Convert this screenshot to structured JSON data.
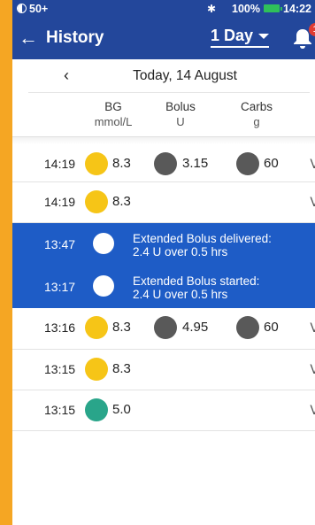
{
  "status": {
    "left": "50+",
    "battery": "100%",
    "clock": "14:22"
  },
  "header": {
    "title": "History",
    "range": "1 Day",
    "notifications": "1"
  },
  "date": "Today, 14 August",
  "columns": [
    {
      "name": "BG",
      "unit": "mmol/L"
    },
    {
      "name": "Bolus",
      "unit": "U"
    },
    {
      "name": "Carbs",
      "unit": "g"
    }
  ],
  "rows": [
    {
      "time": "14:19",
      "bg": "8.3",
      "bolus": "3.15",
      "carbs": "60"
    },
    {
      "time": "14:19",
      "bg": "8.3"
    },
    {
      "time": "13:47",
      "line1": "Extended Bolus delivered:",
      "line2": "2.4 U over 0.5 hrs"
    },
    {
      "time": "13:17",
      "line1": "Extended Bolus started:",
      "line2": "2.4 U over 0.5 hrs"
    },
    {
      "time": "13:16",
      "bg": "8.3",
      "bolus": "4.95",
      "carbs": "60"
    },
    {
      "time": "13:15",
      "bg": "8.3"
    },
    {
      "time": "13:15",
      "bg": "5.0"
    }
  ],
  "colors": {
    "header": "#23479b",
    "highlight": "#1e5cc6",
    "bg_yellow": "#f6c517",
    "bg_green": "#29a58a",
    "icon_dark": "#595959",
    "frame": "#f5a623"
  }
}
